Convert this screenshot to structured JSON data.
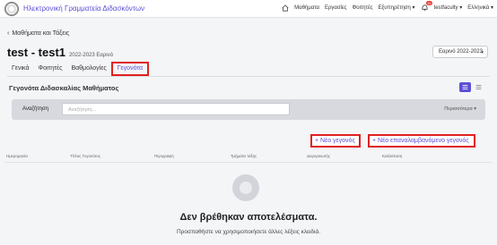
{
  "navbar": {
    "brand": "Ηλεκτρονική Γραμματεία Διδασκόντων",
    "items": [
      "Μαθήματα",
      "Εργασίες",
      "Φοιτητές",
      "Εξυπηρέτηση"
    ],
    "notifications_count": "10",
    "user": "testfaculty",
    "language": "Ελληνικά"
  },
  "back_link": "Μαθήματα και Τάξεις",
  "course": {
    "title": "test - test1",
    "subtitle": "2022-2023 Εαρινό"
  },
  "year_select": {
    "value": "Εαρινό 2022-2023"
  },
  "tabs": [
    "Γενικά",
    "Φοιτητές",
    "Βαθμολογίες",
    "Γεγονότα"
  ],
  "section_title": "Γεγονότα Διδασκαλίας Μαθήματος",
  "filter": {
    "label": "Αναζήτηση",
    "placeholder": "Αναζήτηση...",
    "more": "Περισσότερα"
  },
  "buttons": {
    "new_event": "+ Νέο γεγονός",
    "new_recurring_event": "+ Νέο επαναλαμβανόμενο γεγονός"
  },
  "table_columns": [
    "Ημερομηνία",
    "Τίτλος Γεγονότος",
    "Περιγραφή",
    "Τμήματα τάξης",
    "Διοργανωτής",
    "Κατάσταση"
  ],
  "empty_state": {
    "title": "Δεν βρέθηκαν αποτελέσματα.",
    "subtitle": "Προσπαθήστε να χρησιμοποιήσετε άλλες λέξεις κλειδιά."
  },
  "colors": {
    "accent": "#5b4fd6",
    "highlight": "#e02020"
  }
}
